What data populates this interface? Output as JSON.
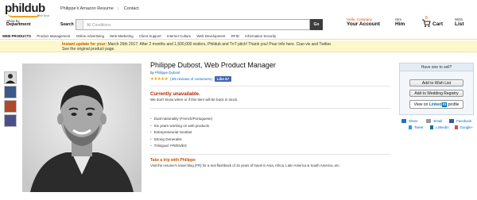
{
  "header": {
    "logo_text": "phildub",
    "logo_tagline": "Tribe Bhat",
    "top_links": [
      "Philippe's Amazon Resume",
      "Contact"
    ],
    "shop_by_line1": "Shop by",
    "shop_by_line2": "Department",
    "search_label": "Search",
    "search_placeholder": "All Conditions",
    "go_label": "Go",
    "account_hello": "Hello, Company",
    "account_label": "Your Account",
    "himm_top": "Him",
    "himm_label": "Him",
    "cart_count": "0",
    "cart_label": "Cart",
    "wish_top": "Wish",
    "wish_label": "List"
  },
  "nav": {
    "items": [
      "WEB PRODUCTS",
      "Product Management",
      "Online Advertising",
      "Web Marketing",
      "Client Support",
      "Internet Culture",
      "Web Development",
      "RFID",
      "Information Security"
    ]
  },
  "banner": {
    "prefix": "Instant update for your:",
    "text": "March 26th 2017: After 2 months and 1,500,000 visitors, Phildub and TnT pitch! Thank you! Pour info here. Ciao vis and Twitter.",
    "line2": "See the original product page."
  },
  "thumbs": [
    "portrait",
    "blue",
    "red",
    "purple"
  ],
  "product": {
    "title": "Philippe Dubost, Web Product Manager",
    "by_prefix": "by",
    "by_name": "Philippe Dubost",
    "stars": "★★★★★",
    "reviews": "(4/5 reviews of customers)",
    "like": "Like 67",
    "availability": "Currently unavailable.",
    "availability_note": "We don't know when or if this item will be back in stock.",
    "bullets": [
      "Dual-nationality (French/Portuguese)",
      "Six years working on web products",
      "Entrepreneurial mindset",
      "Strong Generalist",
      "Trilingual: FR/EN/ES"
    ],
    "trip_title": "Take a trip with Philippe",
    "trip_text": "Visit the resume's travel blog (FR) for a real flashback of 15 years of travel in Asia, Africa, Latin America & South America, etc."
  },
  "buybox": {
    "header": "Have one to sell?",
    "add_wish": "Add to Wish List",
    "add_wedding": "Add to Wedding Registry",
    "view_on": "View on",
    "linked": "Linked",
    "in": "in",
    "profile": "profile"
  },
  "share": {
    "row1": [
      "Share",
      "Email",
      "Facebook"
    ],
    "row2": [
      "Tweet",
      "LinkedIn",
      "Google+"
    ]
  },
  "colors": {
    "accent_orange": "#f2a21b",
    "unavailable_red": "#b12704",
    "link_blue": "#0066c0",
    "banner_yellow": "#fcf8cc"
  }
}
